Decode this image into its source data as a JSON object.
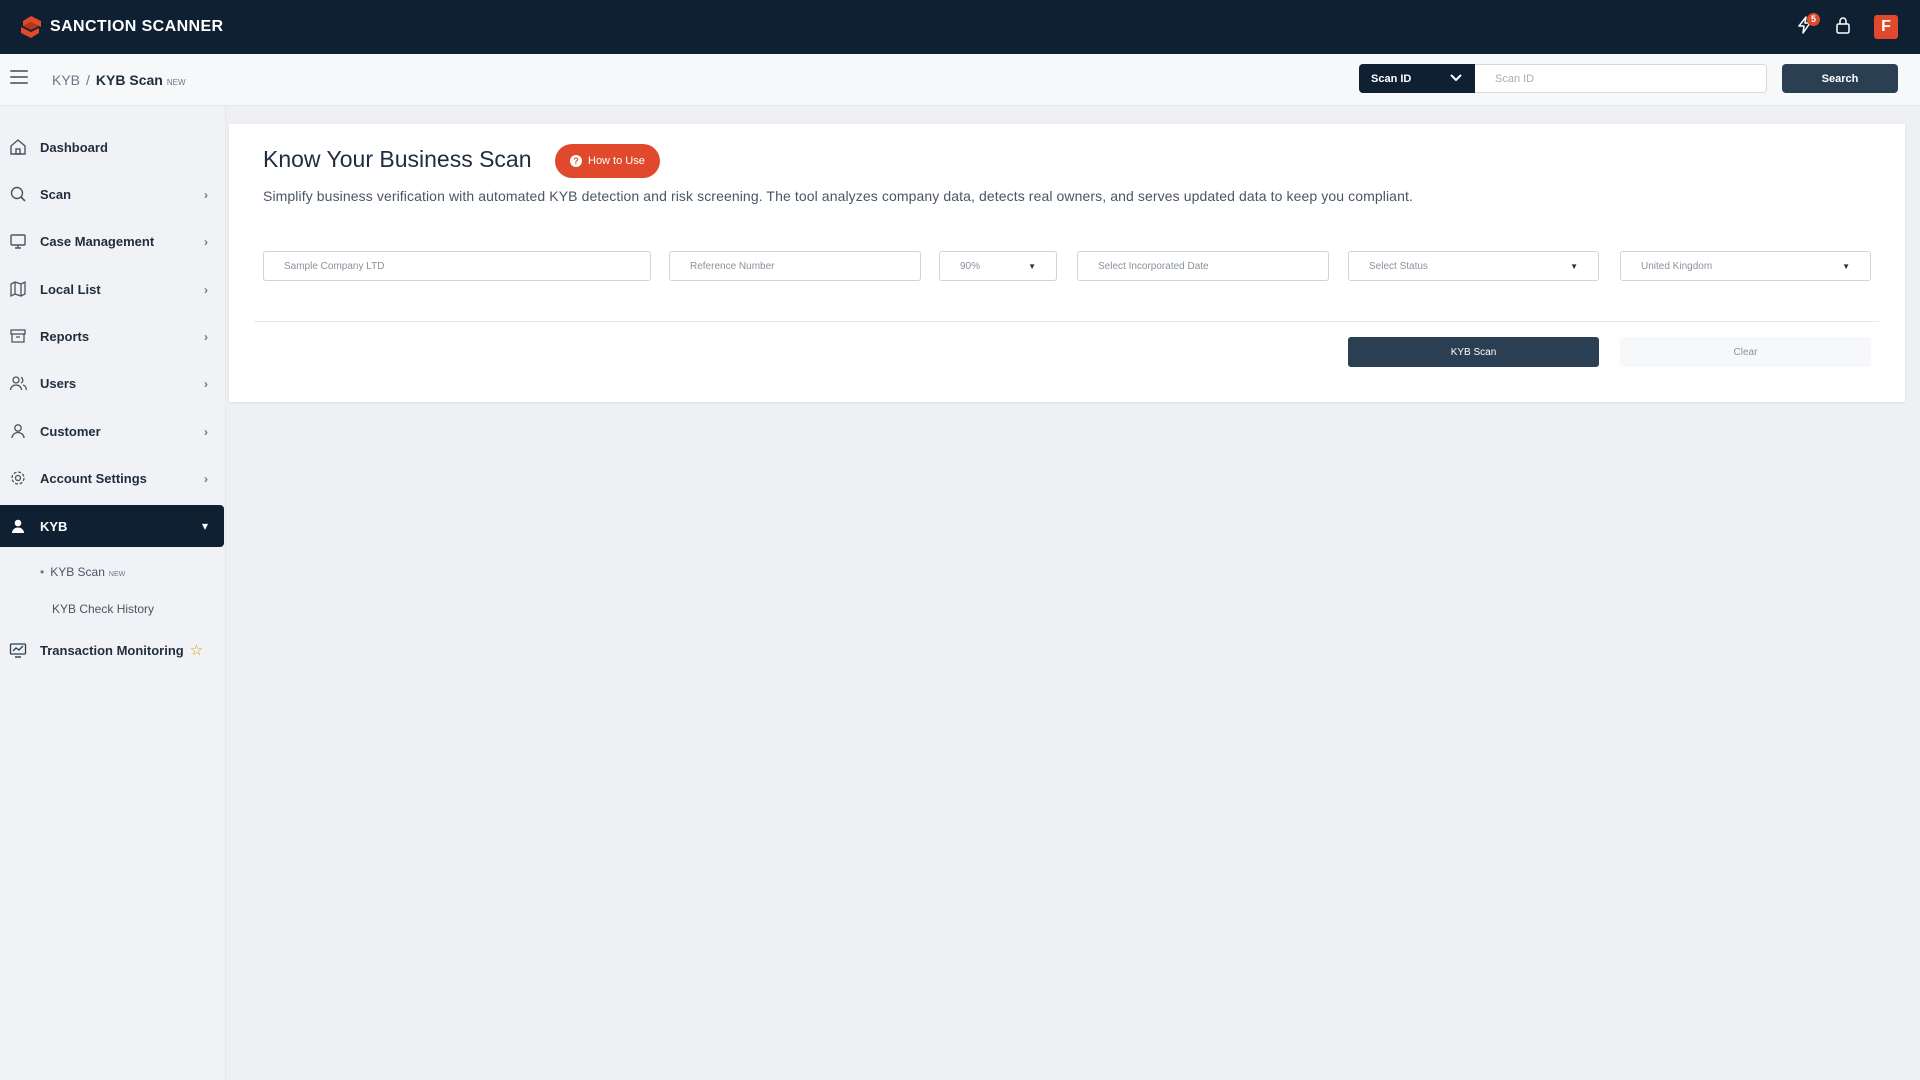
{
  "brand": {
    "name": "SANCTION SCANNER",
    "accent": "#e0492c",
    "navy": "#0f2033"
  },
  "header": {
    "notifications_count": "5",
    "icons": [
      "lightning-icon",
      "lock-icon"
    ],
    "avatar_initial": "F"
  },
  "subbar": {
    "breadcrumb": {
      "parent": "KYB",
      "separator": "/",
      "current": "KYB Scan",
      "current_tag": "NEW"
    },
    "scan_select": {
      "selected": "Scan ID"
    },
    "scan_input": {
      "placeholder": "Scan ID"
    },
    "search_label": "Search"
  },
  "sidebar": {
    "items": [
      {
        "label": "Dashboard",
        "icon": "home-icon"
      },
      {
        "label": "Scan",
        "icon": "search-icon"
      },
      {
        "label": "Case Management",
        "icon": "monitor-icon"
      },
      {
        "label": "Local List",
        "icon": "map-icon"
      },
      {
        "label": "Reports",
        "icon": "archive-icon"
      },
      {
        "label": "Users",
        "icon": "users-icon"
      },
      {
        "label": "Customer",
        "icon": "user-icon"
      },
      {
        "label": "Account Settings",
        "icon": "gear-icon"
      },
      {
        "label": "KYB",
        "icon": "person-icon",
        "active": true
      }
    ],
    "kyb_sub": [
      {
        "label": "KYB Scan",
        "tag": "NEW"
      },
      {
        "label": "KYB Check History"
      }
    ],
    "transaction": {
      "label": "Transaction Monitoring",
      "icon": "chart-monitor-icon",
      "badge_icon": "star-icon"
    }
  },
  "main": {
    "title": "Know Your Business Scan",
    "how_to_use": "How to Use",
    "description": "Simplify business verification with automated KYB detection and risk screening. The tool analyzes company data, detects real owners, and serves updated data to keep you compliant.",
    "fields": {
      "company_placeholder": "Sample Company LTD",
      "reference_placeholder": "Reference Number",
      "match_rate": "90%",
      "date_placeholder": "Select Incorporated Date",
      "status_placeholder": "Select Status",
      "country": "United Kingdom"
    },
    "kyb_scan_label": "KYB Scan",
    "clear_label": "Clear"
  }
}
